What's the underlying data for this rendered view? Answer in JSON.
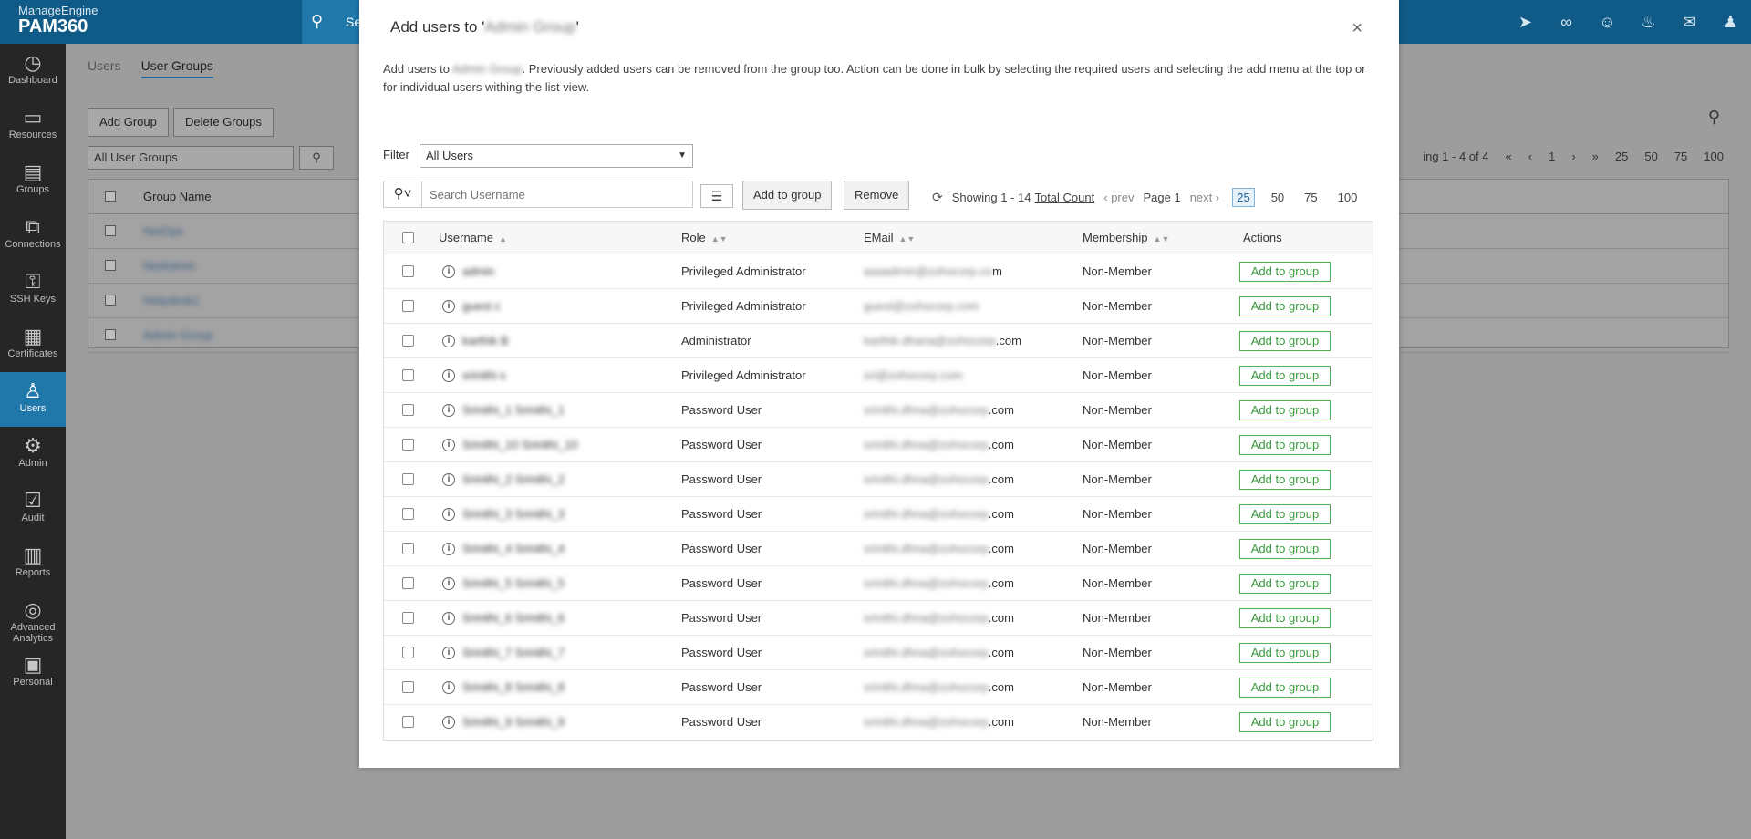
{
  "brand": {
    "sub": "ManageEngine",
    "main": "PAM360"
  },
  "topbar": {
    "search_text": "Se"
  },
  "top_icons": [
    "rocket-icon",
    "plug-icon",
    "person-badge-icon",
    "bell-icon",
    "mail-icon",
    "user-icon"
  ],
  "sidebar": {
    "items": [
      {
        "label": "Dashboard",
        "icon": "◷",
        "name": "dashboard"
      },
      {
        "label": "Resources",
        "icon": "▭",
        "name": "resources"
      },
      {
        "label": "Groups",
        "icon": "▤",
        "name": "groups"
      },
      {
        "label": "Connections",
        "icon": "⧉",
        "name": "connections"
      },
      {
        "label": "SSH Keys",
        "icon": "⚿",
        "name": "ssh-keys"
      },
      {
        "label": "Certificates",
        "icon": "▦",
        "name": "certificates"
      },
      {
        "label": "Users",
        "icon": "♙",
        "name": "users"
      },
      {
        "label": "Admin",
        "icon": "⚙",
        "name": "admin"
      },
      {
        "label": "Audit",
        "icon": "☑",
        "name": "audit"
      },
      {
        "label": "Reports",
        "icon": "▥",
        "name": "reports"
      },
      {
        "label": "Advanced Analytics",
        "icon": "◎",
        "name": "advanced-analytics"
      },
      {
        "label": "Personal",
        "icon": "▣",
        "name": "personal"
      }
    ],
    "active": "Users"
  },
  "bg": {
    "tabs": [
      "Users",
      "User Groups"
    ],
    "add_group": "Add Group",
    "delete_groups": "Delete Groups",
    "select_value": "All User Groups",
    "group_name_header": "Group Name",
    "rows": [
      "",
      "",
      "",
      ""
    ],
    "pager": {
      "text": "ing 1 - 4 of 4",
      "page": "1",
      "sizes": [
        "25",
        "50",
        "75",
        "100"
      ]
    }
  },
  "modal": {
    "title_prefix": "Add users to '",
    "title_group": "Admin Group",
    "title_suffix": "'",
    "desc_prefix": "Add users to ",
    "desc_group": "Admin Group",
    "desc_suffix": ". Previously added users can be removed from the group too. Action can be done in bulk by selecting the required users and selecting the add menu at the top or for individual users withing the list view.",
    "filter_label": "Filter",
    "filter_value": "All Users",
    "search_placeholder": "Search Username",
    "add_to_group": "Add to group",
    "remove": "Remove",
    "pager": {
      "showing": "Showing 1 - 14",
      "total_count": "Total Count",
      "prev": "prev",
      "page": "Page 1",
      "next": "next",
      "sizes": [
        "25",
        "50",
        "75",
        "100"
      ],
      "selected_size": "25"
    },
    "columns": [
      "Username",
      "Role",
      "EMail",
      "Membership",
      "Actions"
    ],
    "rows": [
      {
        "username": "admin",
        "role": "Privileged Administrator",
        "email_blur": "aaaadmin@zohocorp.co",
        "email_tail": "m",
        "membership": "Non-Member",
        "action": "Add to group"
      },
      {
        "username": "guest c",
        "role": "Privileged Administrator",
        "email_blur": "guest@zohocorp.com",
        "email_tail": "",
        "membership": "Non-Member",
        "action": "Add to group"
      },
      {
        "username": "karthik B",
        "role": "Administrator",
        "email_blur": "karthik.dhana@zohocorp",
        "email_tail": ".com",
        "membership": "Non-Member",
        "action": "Add to group"
      },
      {
        "username": "srinithi s",
        "role": "Privileged Administrator",
        "email_blur": "sri@zohocorp.com",
        "email_tail": "",
        "membership": "Non-Member",
        "action": "Add to group"
      },
      {
        "username": "Srinithi_1 Srinithi_1",
        "role": "Password User",
        "email_blur": "srinithi.dhna@zohocorp",
        "email_tail": ".com",
        "membership": "Non-Member",
        "action": "Add to group"
      },
      {
        "username": "Srinithi_10 Srinithi_10",
        "role": "Password User",
        "email_blur": "srinithi.dhna@zohocorp",
        "email_tail": ".com",
        "membership": "Non-Member",
        "action": "Add to group"
      },
      {
        "username": "Srinithi_2 Srinithi_2",
        "role": "Password User",
        "email_blur": "srinithi.dhna@zohocorp",
        "email_tail": ".com",
        "membership": "Non-Member",
        "action": "Add to group"
      },
      {
        "username": "Srinithi_3 Srinithi_3",
        "role": "Password User",
        "email_blur": "srinithi.dhna@zohocorp",
        "email_tail": ".com",
        "membership": "Non-Member",
        "action": "Add to group"
      },
      {
        "username": "Srinithi_4 Srinithi_4",
        "role": "Password User",
        "email_blur": "srinithi.dhna@zohocorp",
        "email_tail": ".com",
        "membership": "Non-Member",
        "action": "Add to group"
      },
      {
        "username": "Srinithi_5 Srinithi_5",
        "role": "Password User",
        "email_blur": "srinithi.dhna@zohocorp",
        "email_tail": ".com",
        "membership": "Non-Member",
        "action": "Add to group"
      },
      {
        "username": "Srinithi_6 Srinithi_6",
        "role": "Password User",
        "email_blur": "srinithi.dhna@zohocorp",
        "email_tail": ".com",
        "membership": "Non-Member",
        "action": "Add to group"
      },
      {
        "username": "Srinithi_7 Srinithi_7",
        "role": "Password User",
        "email_blur": "srinithi.dhna@zohocorp",
        "email_tail": ".com",
        "membership": "Non-Member",
        "action": "Add to group"
      },
      {
        "username": "Srinithi_8 Srinithi_8",
        "role": "Password User",
        "email_blur": "srinithi.dhna@zohocorp",
        "email_tail": ".com",
        "membership": "Non-Member",
        "action": "Add to group"
      },
      {
        "username": "Srinithi_9 Srinithi_9",
        "role": "Password User",
        "email_blur": "srinithi.dhna@zohocorp",
        "email_tail": ".com",
        "membership": "Non-Member",
        "action": "Add to group"
      }
    ]
  },
  "colors": {
    "topbar": "#0f5a86",
    "sidebar": "#262626",
    "accent": "#1f77aa",
    "add_btn": "#4caf50"
  }
}
